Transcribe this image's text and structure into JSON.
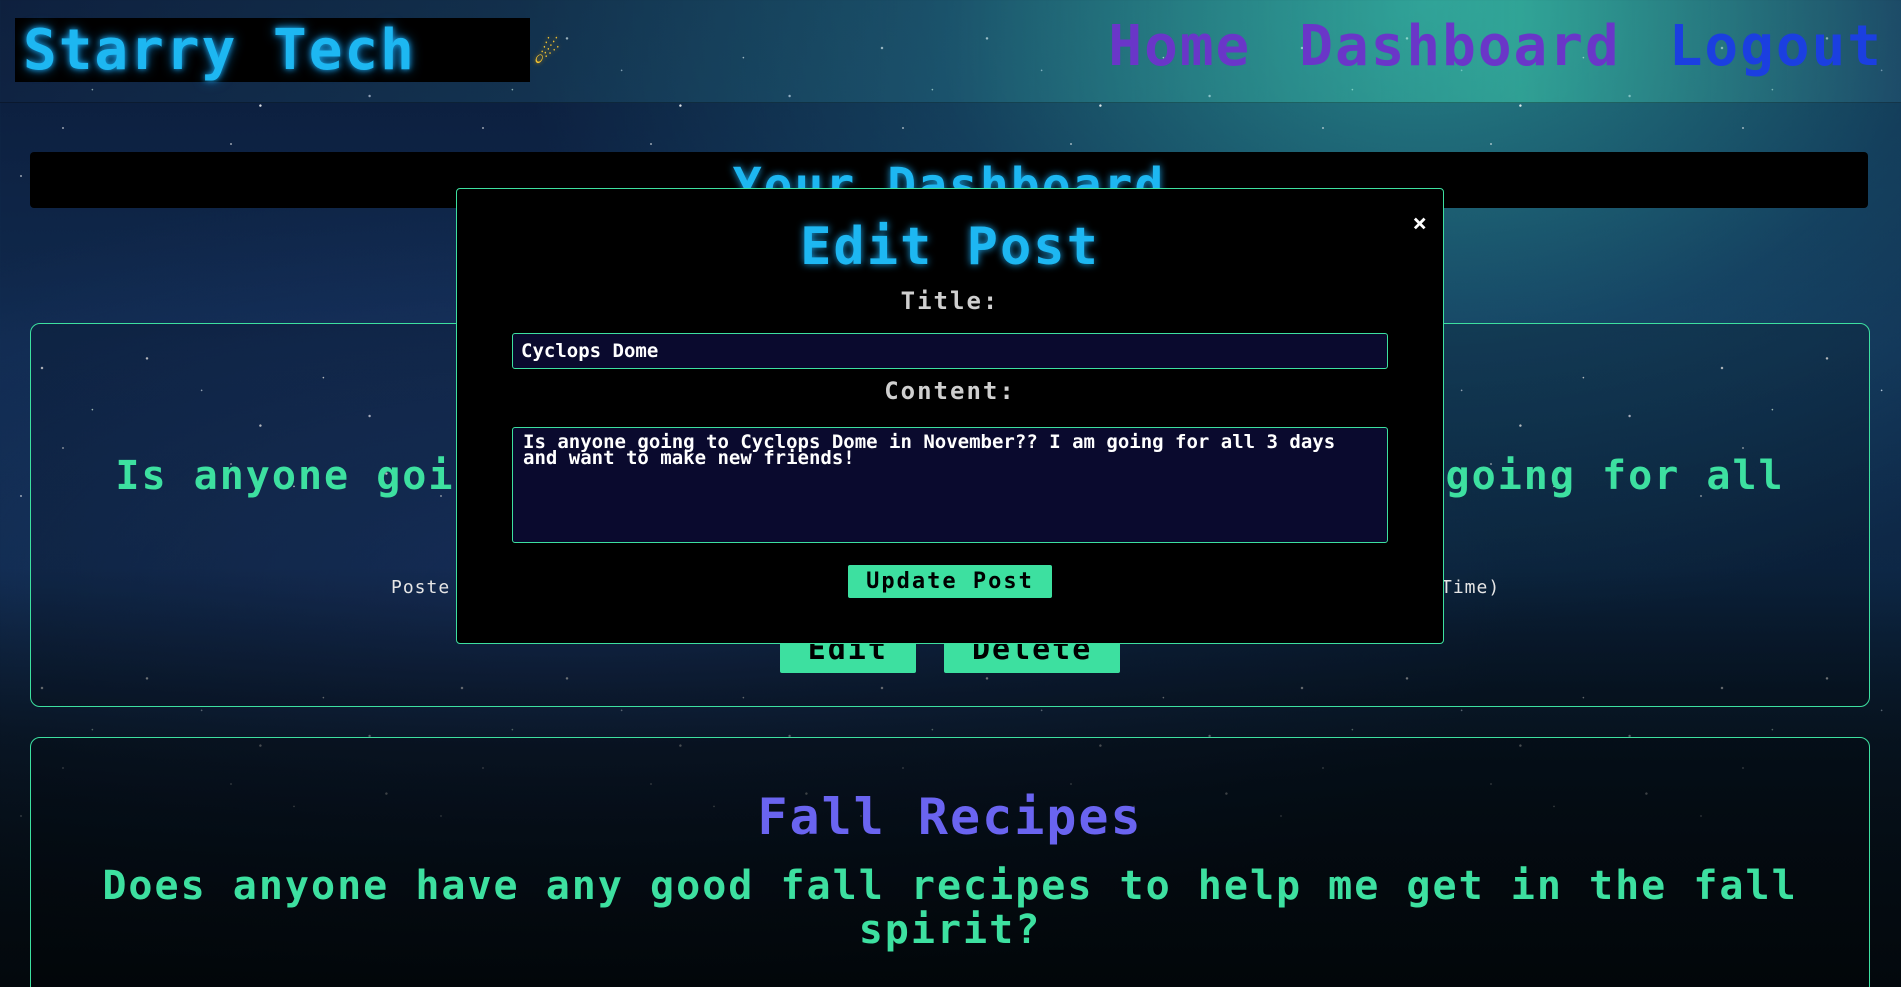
{
  "header": {
    "brand": "Starry Tech",
    "brand_icon": "☄",
    "nav": {
      "home": "Home",
      "dashboard": "Dashboard",
      "logout": "Logout"
    }
  },
  "dashboard": {
    "title": "Your Dashboard"
  },
  "posts": [
    {
      "body": "Is anyone going to Cyclops Dome in November?? I am going for all 3 days and want to make new friends!",
      "meta_left": "Poste",
      "meta_right": "Time)",
      "edit_label": "Edit",
      "delete_label": "Delete"
    },
    {
      "title": "Fall Recipes",
      "body": "Does anyone have any good fall recipes to help me get in the fall spirit?"
    }
  ],
  "modal": {
    "close_symbol": "×",
    "title": "Edit Post",
    "title_label": "Title:",
    "title_value": "Cyclops Dome",
    "content_label": "Content:",
    "content_value": "Is anyone going to Cyclops Dome in November?? I am going for all 3 days and want to make new friends!",
    "submit_label": "Update Post"
  },
  "colors": {
    "accent_green": "#3de0a0",
    "accent_blue": "#1db7f2",
    "nav_purple": "#6a36c8",
    "nav_blue": "#1b3fe0",
    "post_title_purple": "#6a64f0"
  }
}
